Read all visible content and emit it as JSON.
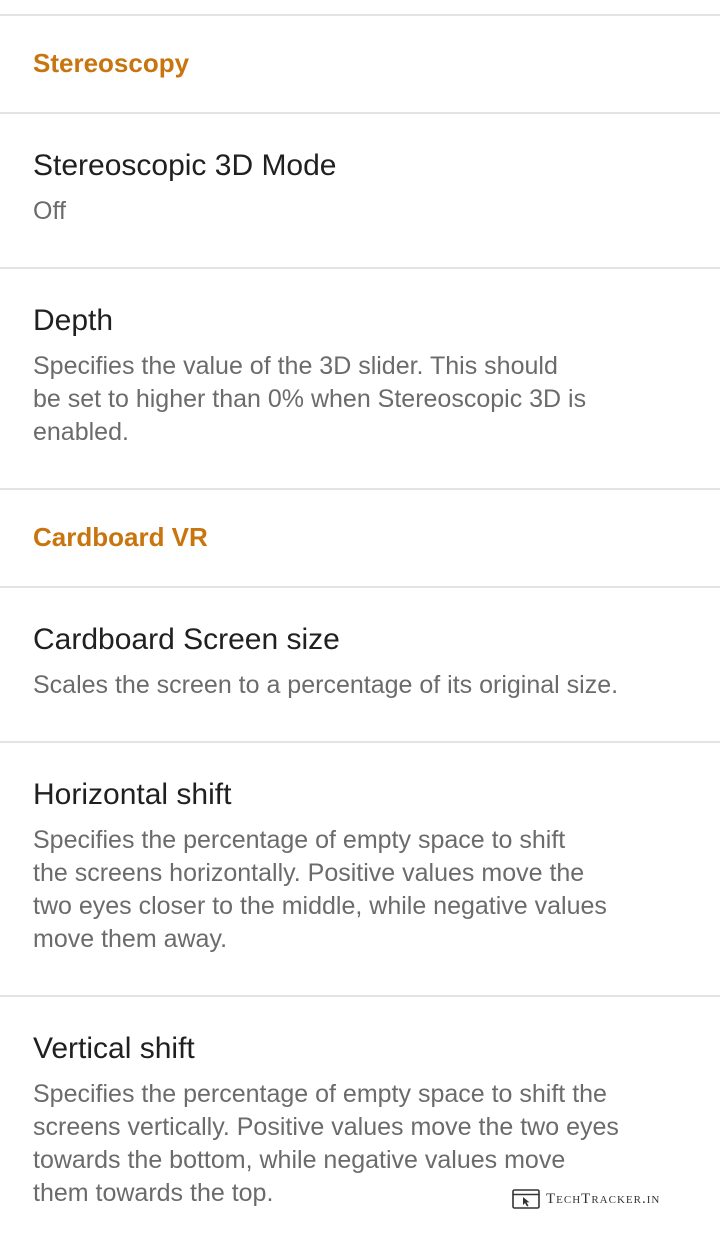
{
  "sections": [
    {
      "header": "Stereoscopy",
      "items": [
        {
          "title": "Stereoscopic 3D Mode",
          "summary": "Off"
        },
        {
          "title": "Depth",
          "summary": "Specifies the value of the 3D slider. This should\nbe set to higher than 0% when Stereoscopic 3D is\nenabled."
        }
      ]
    },
    {
      "header": "Cardboard VR",
      "items": [
        {
          "title": "Cardboard Screen size",
          "summary": "Scales the screen to a percentage of its original size."
        },
        {
          "title": "Horizontal shift",
          "summary": "Specifies the percentage of empty space to shift\nthe screens horizontally. Positive values move the\ntwo eyes closer to the middle, while negative values\nmove them away."
        },
        {
          "title": "Vertical shift",
          "summary": "Specifies the percentage of empty space to shift the\nscreens vertically. Positive values move the two eyes\ntowards the bottom, while negative values move\nthem towards the top."
        }
      ]
    }
  ],
  "watermark": {
    "text": "TechTracker.in",
    "icon": "browser-cursor-icon"
  },
  "colors": {
    "accent": "#c8750f",
    "title": "#202020",
    "summary": "#6b6b6b",
    "divider": "#e3e3e3",
    "background": "#ffffff"
  }
}
